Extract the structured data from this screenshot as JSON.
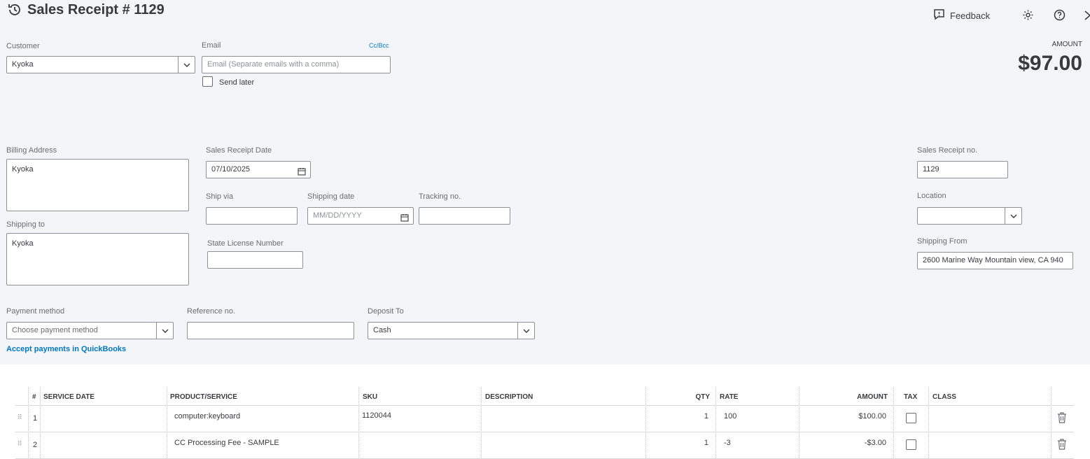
{
  "header": {
    "title": "Sales Receipt # 1129",
    "feedback_label": "Feedback",
    "amount_label": "AMOUNT",
    "amount_value": "$97.00"
  },
  "customer": {
    "label": "Customer",
    "value": "Kyoka"
  },
  "email": {
    "label": "Email",
    "cc_bcc": "Cc/Bcc",
    "placeholder": "Email (Separate emails with a comma)",
    "send_later_label": "Send later",
    "send_later_checked": false
  },
  "billing": {
    "label": "Billing Address",
    "value": "Kyoka"
  },
  "shipping_to": {
    "label": "Shipping to",
    "value": "Kyoka"
  },
  "receipt_date": {
    "label": "Sales Receipt Date",
    "value": "07/10/2025"
  },
  "ship_via": {
    "label": "Ship via",
    "value": ""
  },
  "shipping_date": {
    "label": "Shipping date",
    "placeholder": "MM/DD/YYYY"
  },
  "tracking": {
    "label": "Tracking no.",
    "value": ""
  },
  "state_license": {
    "label": "State License Number",
    "value": ""
  },
  "receipt_no": {
    "label": "Sales Receipt no.",
    "value": "1129"
  },
  "location": {
    "label": "Location",
    "value": ""
  },
  "shipping_from": {
    "label": "Shipping From",
    "value": "2600 Marine Way Mountain view, CA 940"
  },
  "payment_method": {
    "label": "Payment method",
    "placeholder": "Choose payment method",
    "accept_link": "Accept payments in QuickBooks"
  },
  "reference": {
    "label": "Reference no.",
    "value": ""
  },
  "deposit_to": {
    "label": "Deposit To",
    "value": "Cash"
  },
  "table": {
    "headers": {
      "num": "#",
      "service_date": "SERVICE DATE",
      "product": "PRODUCT/SERVICE",
      "sku": "SKU",
      "description": "DESCRIPTION",
      "qty": "QTY",
      "rate": "RATE",
      "amount": "AMOUNT",
      "tax": "TAX",
      "class": "CLASS"
    },
    "rows": [
      {
        "num": "1",
        "service_date": "",
        "product": "computer:keyboard",
        "sku": "1120044",
        "description": "",
        "qty": "1",
        "rate": "100",
        "amount": "$100.00",
        "tax": false,
        "class": ""
      },
      {
        "num": "2",
        "service_date": "",
        "product": "CC Processing Fee - SAMPLE",
        "sku": "",
        "description": "",
        "qty": "1",
        "rate": "-3",
        "amount": "-$3.00",
        "tax": false,
        "class": ""
      }
    ]
  },
  "colors": {
    "accent": "#0077c5",
    "background": "#f4f5f8",
    "text": "#393a3d"
  }
}
